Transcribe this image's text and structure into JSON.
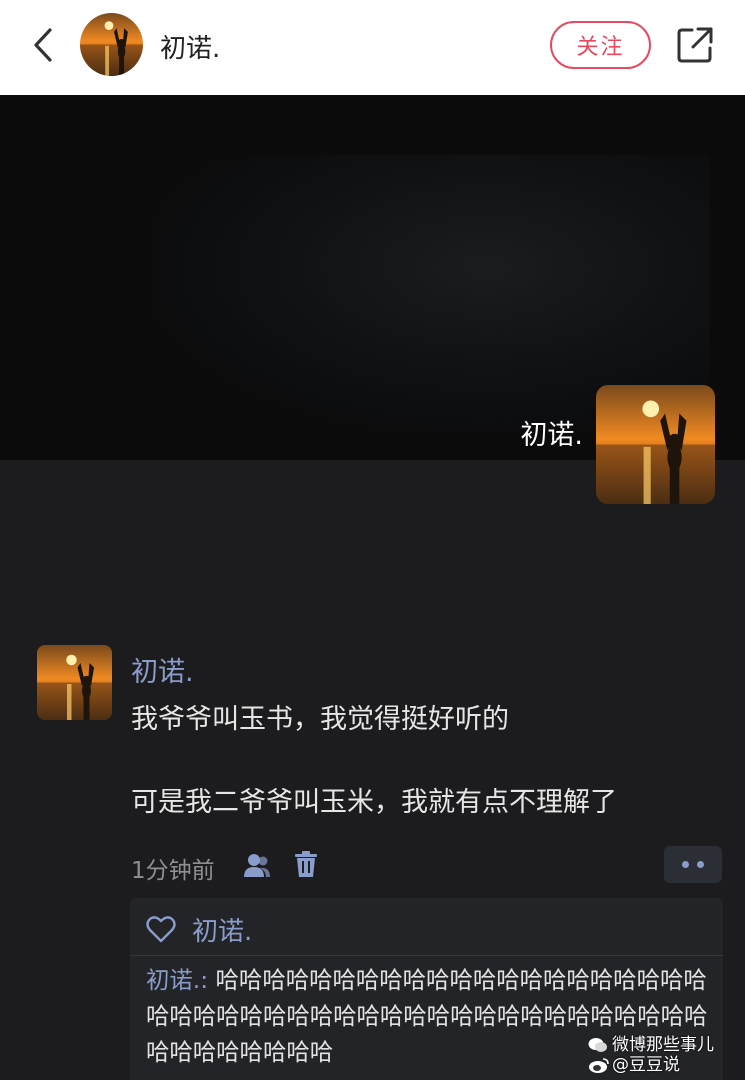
{
  "header": {
    "title": "初诺.",
    "follow_label": "关注"
  },
  "hero": {
    "name": "初诺."
  },
  "comment": {
    "author": "初诺.",
    "line1": "我爷爷叫玉书，我觉得挺好听的",
    "line2": "可是我二爷爷叫玉米，我就有点不理解了",
    "time": "1分钟前"
  },
  "reply": {
    "liked_by": "初诺.",
    "author": "初诺.:",
    "text": " 哈哈哈哈哈哈哈哈哈哈哈哈哈哈哈哈哈哈哈哈哈哈哈哈哈哈哈哈哈哈哈哈哈哈哈哈哈哈哈哈哈哈哈哈哈哈哈哈哈哈哈哈哈"
  },
  "watermark": {
    "line1": "微博那些事儿",
    "line2": "@豆豆说"
  },
  "icons": {
    "back": "chevron-left-icon",
    "share": "share-icon",
    "user": "user-icon",
    "delete": "trash-icon",
    "more": "more-dots-icon",
    "like": "heart-icon"
  },
  "colors": {
    "accent_red": "#e84a5f",
    "name_blue": "#8a9cc9",
    "background": "#1c1c1e"
  }
}
